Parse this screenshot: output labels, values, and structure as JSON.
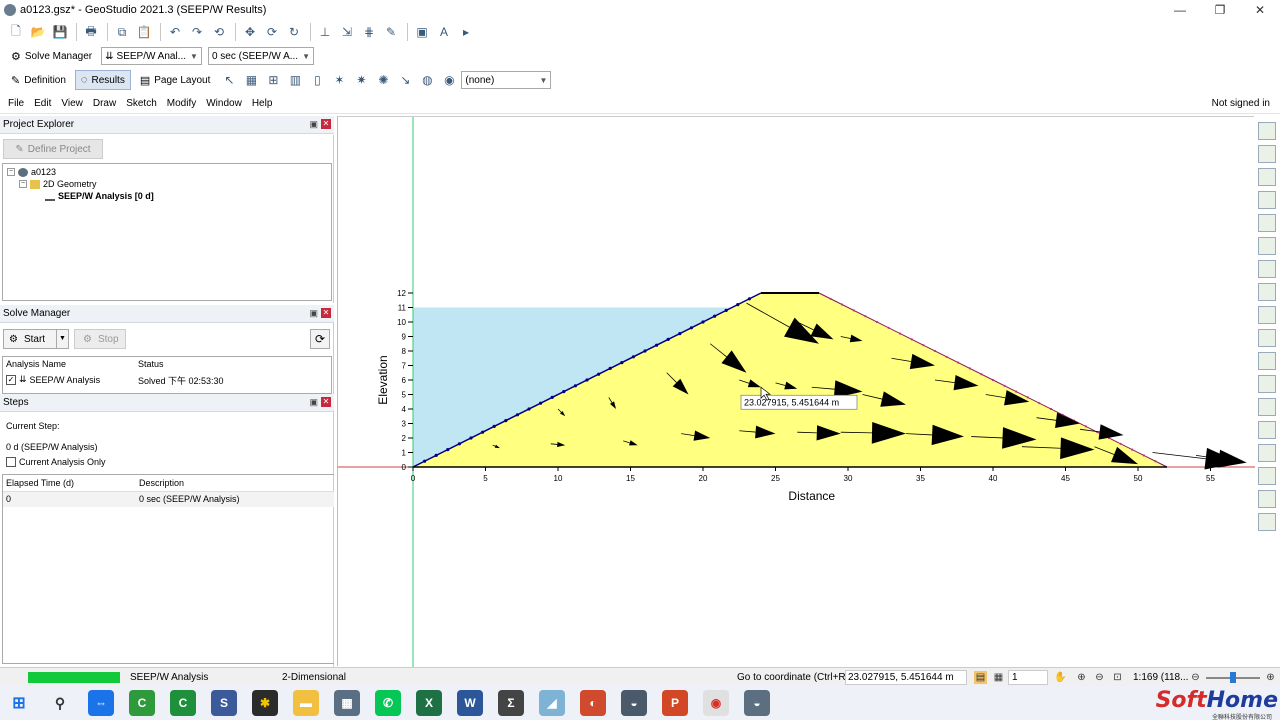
{
  "window": {
    "title": "a0123.gsz* - GeoStudio 2021.3 (SEEP/W Results)",
    "controls": [
      "—",
      "❐",
      "✕"
    ]
  },
  "toolbar2": {
    "solve_manager": "Solve Manager",
    "analysis_combo": "SEEP/W Anal...",
    "time_combo": "0 sec (SEEP/W A..."
  },
  "toolbar3": {
    "definition": "Definition",
    "results": "Results",
    "page_layout": "Page Layout",
    "results_combo": "(none)"
  },
  "menu": {
    "items": [
      "File",
      "Edit",
      "View",
      "Draw",
      "Sketch",
      "Modify",
      "Window",
      "Help"
    ],
    "signin": "Not signed in"
  },
  "project_explorer": {
    "title": "Project Explorer",
    "define_button": "Define Project",
    "tree": {
      "root": "a0123",
      "geometry": "2D Geometry",
      "analysis": "SEEP/W Analysis [0 d]"
    }
  },
  "solve_manager": {
    "title": "Solve Manager",
    "start": "Start",
    "stop": "Stop",
    "columns": [
      "Analysis Name",
      "Status"
    ],
    "row": {
      "name": "SEEP/W Analysis",
      "status": "Solved 下午 02:53:30"
    }
  },
  "steps": {
    "title": "Steps",
    "current_step_label": "Current Step:",
    "current_step_value": "0 d (SEEP/W Analysis)",
    "current_only_label": "Current Analysis Only",
    "columns": [
      "Elapsed Time (d)",
      "Description"
    ],
    "row": {
      "time": "0",
      "desc": "0 sec (SEEP/W Analysis)"
    }
  },
  "chart_data": {
    "type": "area",
    "xlabel": "Distance",
    "ylabel": "Elevation",
    "xlim": [
      0,
      57
    ],
    "ylim": [
      0,
      12
    ],
    "xticks": [
      0,
      5,
      10,
      15,
      20,
      25,
      30,
      35,
      40,
      45,
      50,
      55
    ],
    "yticks": [
      0,
      1,
      2,
      3,
      4,
      5,
      6,
      7,
      8,
      9,
      10,
      11,
      12
    ],
    "dam_outline": [
      [
        0,
        0
      ],
      [
        24,
        12
      ],
      [
        28,
        12
      ],
      [
        52,
        0
      ]
    ],
    "water_level": 11,
    "flow_vectors": [
      [
        23,
        11.3,
        28,
        8.5
      ],
      [
        26.5,
        10,
        29,
        8.8
      ],
      [
        29.5,
        9,
        31,
        8.7
      ],
      [
        33,
        7.5,
        36,
        7
      ],
      [
        36,
        6,
        39,
        5.6
      ],
      [
        39.5,
        5,
        42.5,
        4.5
      ],
      [
        43,
        3.4,
        46,
        3
      ],
      [
        46,
        2.6,
        49,
        2.2
      ],
      [
        20.5,
        8.5,
        23,
        6.5
      ],
      [
        17.5,
        6.5,
        19,
        5
      ],
      [
        13.5,
        4.8,
        14,
        4
      ],
      [
        10,
        4,
        10.5,
        3.5
      ],
      [
        22.5,
        6,
        24,
        5.5
      ],
      [
        25,
        5.8,
        26.5,
        5.4
      ],
      [
        27.5,
        5.5,
        31,
        5.2
      ],
      [
        31,
        5,
        34,
        4.3
      ],
      [
        22.5,
        2.5,
        25,
        2.3
      ],
      [
        26.5,
        2.4,
        29.5,
        2.3
      ],
      [
        29.5,
        2.4,
        34,
        2.3
      ],
      [
        34,
        2.3,
        38,
        2.1
      ],
      [
        38.5,
        2.1,
        43,
        1.9
      ],
      [
        42,
        1.4,
        47,
        1.2
      ],
      [
        47,
        1.4,
        50,
        0.2
      ],
      [
        18.5,
        2.3,
        20.5,
        2
      ],
      [
        14.5,
        1.8,
        15.5,
        1.5
      ],
      [
        9.5,
        1.6,
        10.5,
        1.5
      ],
      [
        5.5,
        1.5,
        6,
        1.3
      ],
      [
        51,
        1,
        57,
        0.3
      ],
      [
        54,
        0.8,
        57.5,
        0.3
      ]
    ],
    "cursor_label": "23.027915, 5.451644 m",
    "cursor_point": [
      24,
      5.5
    ]
  },
  "status": {
    "mode": "SEEP/W Analysis",
    "dimension": "2-Dimensional",
    "goto_label": "Go to coordinate (Ctrl+R):",
    "goto_value": "23.027915, 5.451644 m",
    "page": "1",
    "scale": "1:169 (118..."
  },
  "taskbar": {
    "brand_soft": "Soft",
    "brand_home": "Home",
    "brand_sub": "全聯科技股份有限公司"
  },
  "colors": {
    "water": "#bfe6f2",
    "dam": "#ffff80",
    "outline": "#000080",
    "progress": "#11c93a"
  }
}
